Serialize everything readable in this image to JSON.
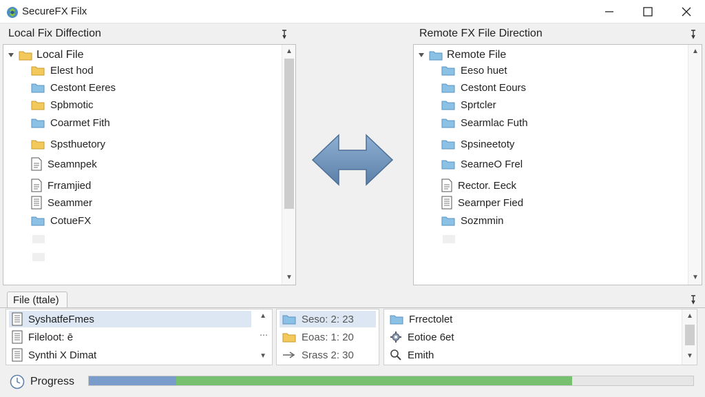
{
  "window": {
    "title": "SecureFX Filx",
    "buttons": [
      "minimize",
      "maximize",
      "close"
    ]
  },
  "local_pane": {
    "header": "Local Fix Diffection",
    "root_label": "Local File",
    "items": [
      {
        "label": "Elest hod",
        "icon": "folder-yellow-icon"
      },
      {
        "label": "Cestont Eeres",
        "icon": "folder-blue-icon"
      },
      {
        "label": "Spbmotic",
        "icon": "folder-yellow-icon"
      },
      {
        "label": "Coarmet Fith",
        "icon": "folder-blue-icon"
      },
      {
        "label": "Spsthuetory",
        "icon": "folder-yellow-icon"
      },
      {
        "label": "Seamnpek",
        "icon": "file-doc-icon"
      },
      {
        "label": "Frramjied",
        "icon": "file-doc-icon"
      },
      {
        "label": "Seammer",
        "icon": "file-list-icon"
      },
      {
        "label": "CotueFX",
        "icon": "folder-blue-icon"
      }
    ]
  },
  "remote_pane": {
    "header": "Remote FX File Direction",
    "root_label": "Remote File",
    "items": [
      {
        "label": "Eeso huet",
        "icon": "folder-blue-icon"
      },
      {
        "label": "Cestont Eours",
        "icon": "folder-blue-icon"
      },
      {
        "label": "Sprtcler",
        "icon": "folder-blue-icon"
      },
      {
        "label": "Searmlac Futh",
        "icon": "folder-blue-icon"
      },
      {
        "label": "Spsineetoty",
        "icon": "folder-blue-icon"
      },
      {
        "label": "SearneO Frel",
        "icon": "folder-blue-icon"
      },
      {
        "label": "Rector. Eeck",
        "icon": "file-doc-icon"
      },
      {
        "label": "Searnper Fied",
        "icon": "file-list-icon"
      },
      {
        "label": "Sozmmin",
        "icon": "folder-blue-icon"
      }
    ]
  },
  "transfer_icon": "bidirectional-arrow-icon",
  "bottom_panel": {
    "tab_label": "File (ttale)",
    "files": [
      {
        "label": "SyshatfeFmes",
        "selected": true
      },
      {
        "label": "Fileloot: ē",
        "selected": false
      },
      {
        "label": "Synthi X Dimat",
        "selected": false
      }
    ],
    "status": [
      {
        "label": "Seso: 2: 23",
        "icon": "folder-blue-icon",
        "selected": true
      },
      {
        "label": "Eoas: 1: 20",
        "icon": "folder-yellow-icon",
        "selected": false
      },
      {
        "label": "Srass 2: 30",
        "icon": "arrow-right-icon",
        "selected": false
      }
    ],
    "details": [
      {
        "label": "Frrectolet",
        "icon": "folder-blue-icon"
      },
      {
        "label": "Eotioe 6et",
        "icon": "gear-icon"
      },
      {
        "label": "Emith",
        "icon": "search-icon"
      }
    ]
  },
  "progress": {
    "label": "Progress",
    "segment1_fraction": 0.145,
    "segment2_fraction": 0.655,
    "colors": {
      "segment1": "#7a9ccb",
      "segment2": "#76c06f"
    }
  }
}
